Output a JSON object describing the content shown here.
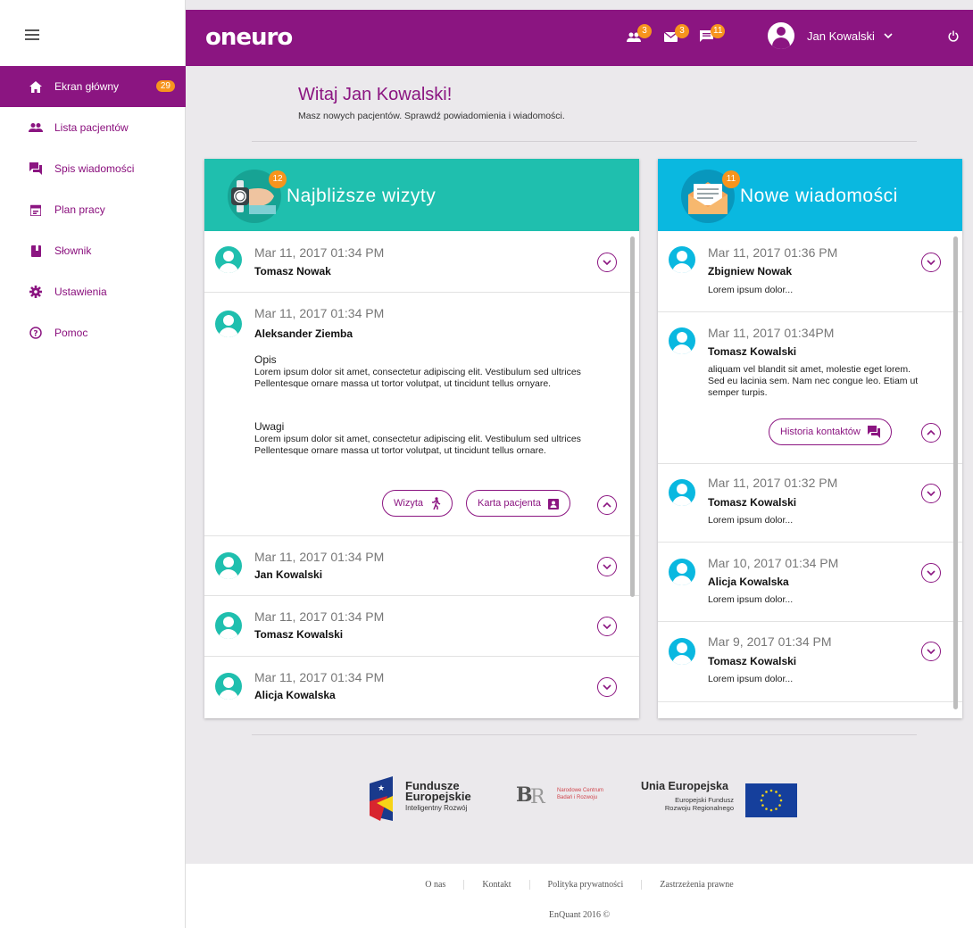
{
  "app": {
    "logo": "oneuro"
  },
  "header": {
    "patients_badge": "3",
    "mail_badge": "3",
    "messages_badge": "11",
    "user_name": "Jan Kowalski"
  },
  "sidebar": {
    "items": [
      {
        "label": "Ekran główny",
        "badge": "29",
        "icon": "home-icon"
      },
      {
        "label": "Lista pacjentów",
        "icon": "people-icon"
      },
      {
        "label": "Spis wiadomości",
        "icon": "forum-icon"
      },
      {
        "label": "Plan pracy",
        "icon": "calendar-icon"
      },
      {
        "label": "Słownik",
        "icon": "book-icon"
      },
      {
        "label": "Ustawienia",
        "icon": "gear-icon"
      },
      {
        "label": "Pomoc",
        "icon": "help-icon"
      }
    ]
  },
  "welcome": {
    "title": "Witaj Jan Kowalski!",
    "subtitle": "Masz nowych pacjentów. Sprawdź powiadomienia i wiadomości."
  },
  "visits": {
    "title": "Najbliższe wizyty",
    "badge": "12",
    "items": [
      {
        "date": "Mar 11, 2017 01:34 PM",
        "name": "Tomasz Nowak"
      },
      {
        "date": "Mar 11, 2017 01:34 PM",
        "name": "Aleksander Ziemba",
        "desc_label": "Opis",
        "desc": "Lorem ipsum dolor sit amet, consectetur adipiscing elit. Vestibulum sed ultrices Pellentesque ornare massa ut tortor volutpat, ut tincidunt tellus ornyare.",
        "notes_label": "Uwagi",
        "notes": "Lorem ipsum dolor sit amet, consectetur adipiscing elit. Vestibulum sed ultrices Pellentesque ornare massa ut tortor volutpat, ut tincidunt tellus ornare.",
        "visit_button": "Wizyta",
        "card_button": "Karta pacjenta"
      },
      {
        "date": "Mar 11, 2017 01:34 PM",
        "name": "Jan Kowalski"
      },
      {
        "date": "Mar 11, 2017 01:34 PM",
        "name": "Tomasz Kowalski"
      },
      {
        "date": "Mar 11, 2017 01:34 PM",
        "name": "Alicja Kowalska"
      }
    ]
  },
  "messages": {
    "title": "Nowe wiadomości",
    "badge": "11",
    "items": [
      {
        "date": "Mar 11, 2017 01:36 PM",
        "name": "Zbigniew Nowak",
        "text": "Lorem ipsum dolor..."
      },
      {
        "date": "Mar 11, 2017 01:34PM",
        "name": "Tomasz Kowalski",
        "text": "aliquam vel blandit sit amet, molestie eget lorem. Sed eu lacinia sem. Nam nec congue leo. Etiam ut semper turpis.",
        "history_button": "Historia kontaktów"
      },
      {
        "date": "Mar 11, 2017 01:32 PM",
        "name": "Tomasz Kowalski",
        "text": "Lorem ipsum dolor..."
      },
      {
        "date": "Mar 10, 2017 01:34 PM",
        "name": "Alicja Kowalska",
        "text": "Lorem ipsum dolor..."
      },
      {
        "date": "Mar 9, 2017 01:34 PM",
        "name": "Tomasz Kowalski",
        "text": "Lorem ipsum dolor..."
      }
    ]
  },
  "partners": {
    "fe_line1": "Fundusze",
    "fe_line2": "Europejskie",
    "fe_line3": "Inteligentny Rozwój",
    "ncbr_line1": "Narodowe Centrum",
    "ncbr_line2": "Badań i Rozwoju",
    "ue_line1": "Unia Europejska",
    "ue_line2": "Europejski Fundusz",
    "ue_line3": "Rozwoju Regionalnego"
  },
  "footer": {
    "links": [
      "O nas",
      "Kontakt",
      "Polityka prywatności",
      "Zastrzeżenia prawne"
    ],
    "copyright": "EnQuant 2016 ©"
  },
  "colors": {
    "brand": "#8b1581",
    "accent": "#f7941d",
    "visits_header": "#1fbfae",
    "messages_header": "#0ab8e0"
  }
}
